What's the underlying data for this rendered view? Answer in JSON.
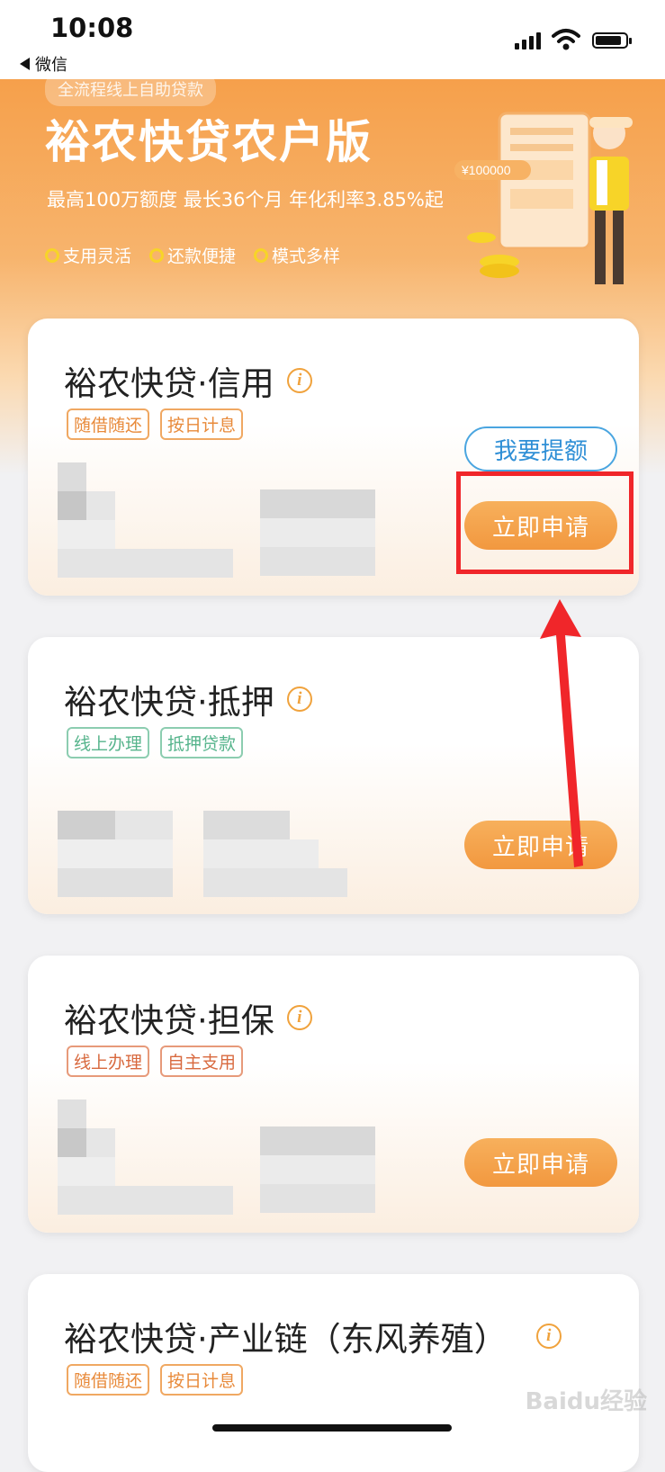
{
  "status_bar": {
    "time": "10:08",
    "back_label": "微信"
  },
  "banner": {
    "pill": "全流程线上自助贷款",
    "title": "裕农快贷农户版",
    "subtitle": "最高100万额度 最长36个月 年化利率3.85%起",
    "features": [
      "支用灵活",
      "还款便捷",
      "模式多样"
    ],
    "illustration_amount": "¥100000"
  },
  "products": [
    {
      "title": "裕农快贷·信用",
      "tags": [
        "随借随还",
        "按日计息"
      ],
      "tag_style": "orange",
      "secondary_button": "我要提额",
      "apply_button": "立即申请"
    },
    {
      "title": "裕农快贷·抵押",
      "tags": [
        "线上办理",
        "抵押贷款"
      ],
      "tag_style": "green",
      "apply_button": "立即申请"
    },
    {
      "title": "裕农快贷·担保",
      "tags": [
        "线上办理",
        "自主支用"
      ],
      "tag_style": "red",
      "apply_button": "立即申请"
    },
    {
      "title": "裕农快贷·产业链（东风养殖）",
      "tags": [
        "随借随还",
        "按日计息"
      ],
      "tag_style": "orange"
    }
  ],
  "watermark": "Baidu经验",
  "colors": {
    "accent": "#f2983f",
    "highlight": "#f0262a",
    "link_blue": "#2f8fd6"
  }
}
